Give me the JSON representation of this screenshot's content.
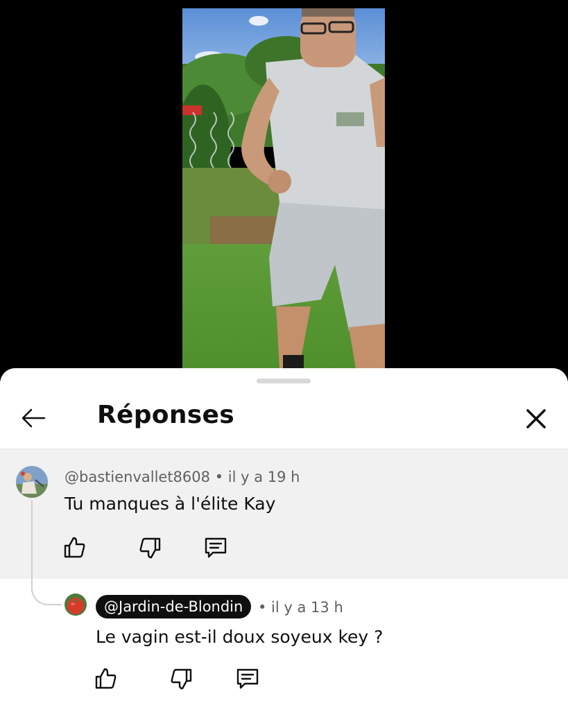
{
  "video": {
    "description_icon": "video-frame-person-in-garden"
  },
  "panel": {
    "title": "Réponses",
    "back_icon": "arrow-left-icon",
    "close_icon": "close-icon"
  },
  "parent_comment": {
    "author": "@bastienvallet8608",
    "time": "• il y a 19 h",
    "text": "Tu manques à l'élite Kay",
    "actions": [
      "like-icon",
      "dislike-icon",
      "reply-icon"
    ]
  },
  "reply": {
    "author": "@Jardin-de-Blondin",
    "time": "• il y a 13 h",
    "text": "Le vagin est-il doux soyeux key ?",
    "actions": [
      "like-icon",
      "dislike-icon",
      "reply-icon"
    ]
  },
  "colors": {
    "text_primary": "#0f0f0f",
    "text_secondary": "#606060",
    "highlight_bg": "#f1f1f1",
    "pill_bg": "#0f0f0f"
  }
}
